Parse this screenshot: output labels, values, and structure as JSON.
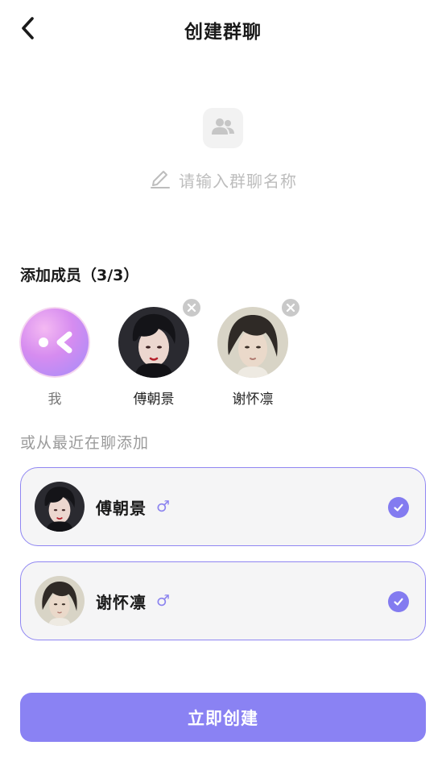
{
  "header": {
    "back_icon": "chevron-left-icon",
    "title": "创建群聊"
  },
  "group": {
    "avatar_icon": "group-users-icon",
    "edit_icon": "pencil-icon",
    "name_placeholder": "请输入群聊名称"
  },
  "members": {
    "title": "添加成员（3/3）",
    "list": [
      {
        "name": "我",
        "avatar": "app-logo-avatar",
        "removable": false
      },
      {
        "name": "傅朝景",
        "avatar": "portrait-avatar",
        "removable": true
      },
      {
        "name": "谢怀凛",
        "avatar": "portrait-avatar",
        "removable": true
      }
    ],
    "remove_icon": "close-icon"
  },
  "recent": {
    "title": "或从最近在聊添加",
    "contacts": [
      {
        "name": "傅朝景",
        "gender": "♂",
        "selected": true
      },
      {
        "name": "谢怀凛",
        "gender": "♂",
        "selected": true
      }
    ],
    "check_icon": "checkmark-icon"
  },
  "actions": {
    "create_label": "立即创建"
  },
  "colors": {
    "accent": "#8a82f3",
    "card_border": "#8f86f2",
    "check_bg": "#837bf0",
    "placeholder": "#bdbdbd"
  }
}
